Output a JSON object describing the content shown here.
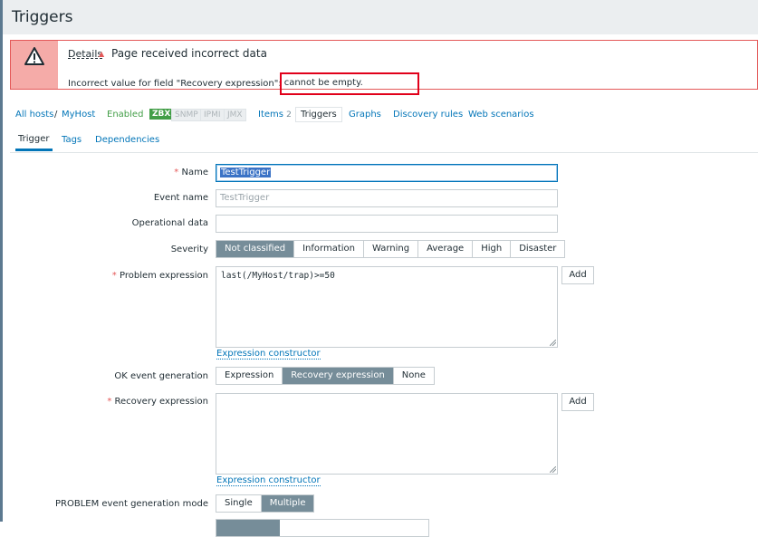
{
  "page_title": "Triggers",
  "message": {
    "details": "Details",
    "title": "Page received incorrect data",
    "line_prefix": "Incorrect value for field \"Recovery expression\":",
    "line_highlight": " cannot be empty."
  },
  "host_nav": {
    "all_hosts": "All hosts",
    "separator": "/",
    "host": "MyHost",
    "status": "Enabled",
    "zbx": "ZBX",
    "snmp": "SNMP",
    "ipmi": "IPMI",
    "jmx": "JMX",
    "items": "Items",
    "items_count": "2",
    "triggers": "Triggers",
    "graphs": "Graphs",
    "discovery": "Discovery rules",
    "web": "Web scenarios"
  },
  "form_tabs": [
    "Trigger",
    "Tags",
    "Dependencies"
  ],
  "form": {
    "name_label": "Name",
    "name_value": "TestTrigger",
    "event_name_label": "Event name",
    "event_name_placeholder": "TestTrigger",
    "opdata_label": "Operational data",
    "severity_label": "Severity",
    "severity": [
      "Not classified",
      "Information",
      "Warning",
      "Average",
      "High",
      "Disaster"
    ],
    "problem_label": "Problem expression",
    "problem_value": "last(/MyHost/trap)>=50",
    "add_label": "Add",
    "expr_constructor": "Expression constructor",
    "ok_gen_label": "OK event generation",
    "ok_gen": [
      "Expression",
      "Recovery expression",
      "None"
    ],
    "recovery_label": "Recovery expression",
    "recovery_value": "",
    "problem_mode_label": "PROBLEM event generation mode",
    "problem_mode": [
      "Single",
      "Multiple"
    ]
  },
  "colors": {
    "error_border": "#e45959",
    "highlight_box": "#e1001a",
    "link": "#0275b8",
    "enabled": "#429e47",
    "segment_active": "#768d99"
  }
}
